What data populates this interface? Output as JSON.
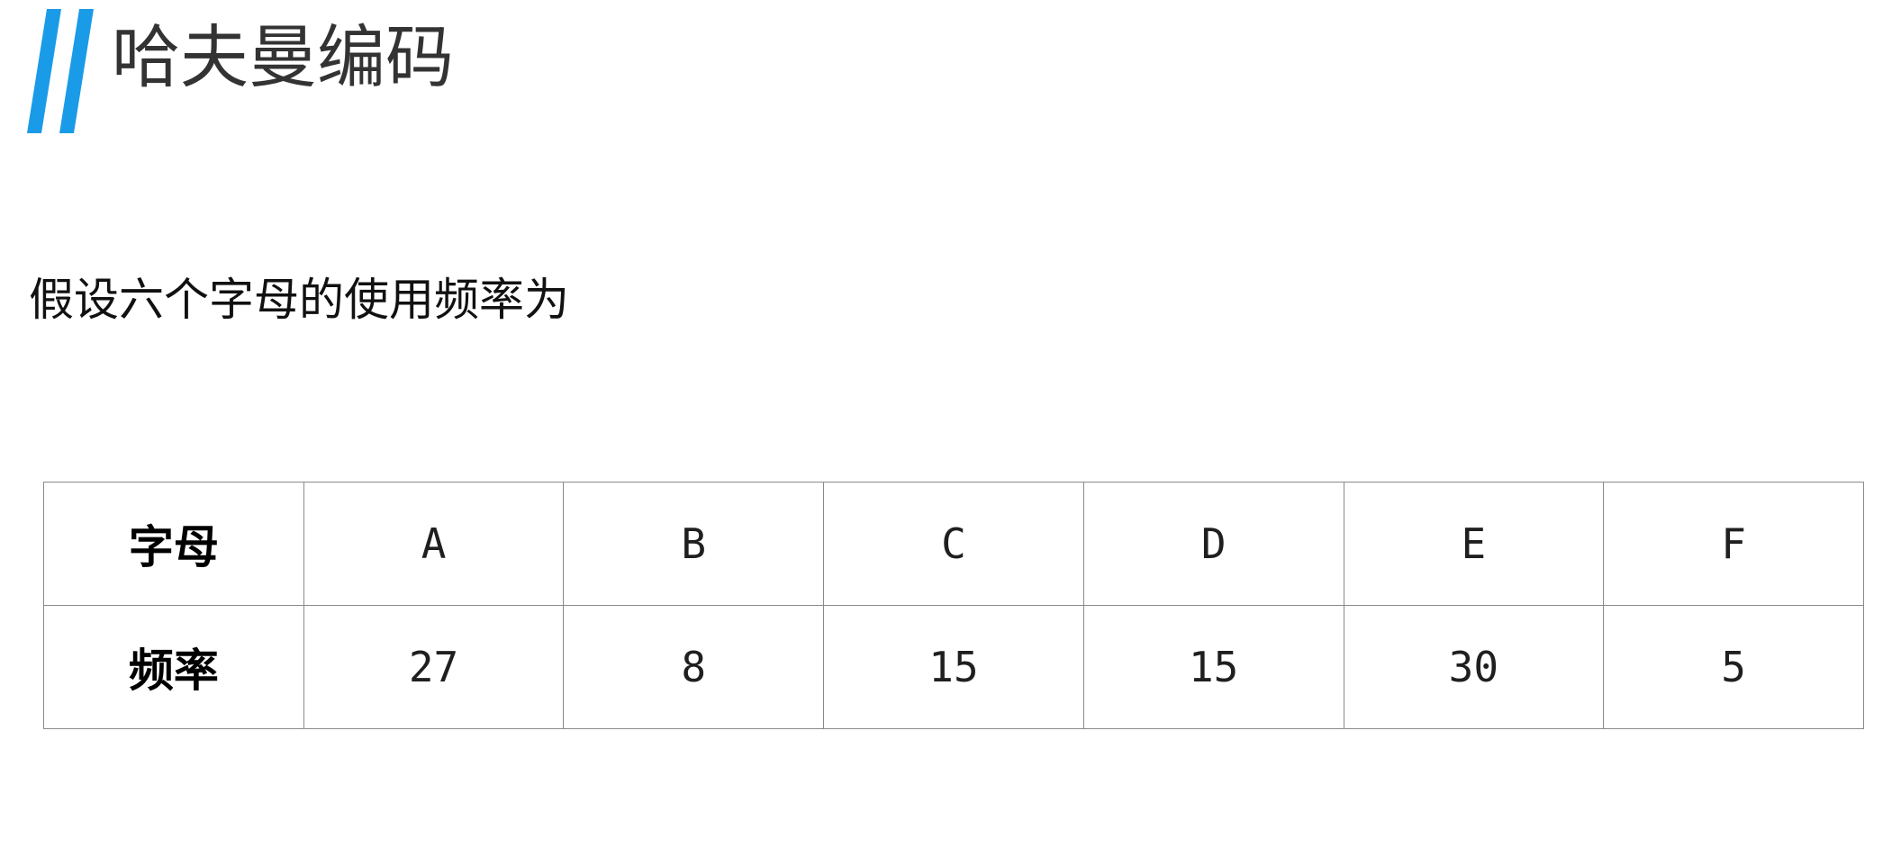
{
  "header": {
    "title": "哈夫曼编码",
    "accent_color": "#1a9be8"
  },
  "body": {
    "intro": "假设六个字母的使用频率为"
  },
  "table": {
    "rows": [
      {
        "label": "字母",
        "cells": [
          "A",
          "B",
          "C",
          "D",
          "E",
          "F"
        ]
      },
      {
        "label": "频率",
        "cells": [
          "27",
          "8",
          "15",
          "15",
          "30",
          "5"
        ]
      }
    ]
  }
}
